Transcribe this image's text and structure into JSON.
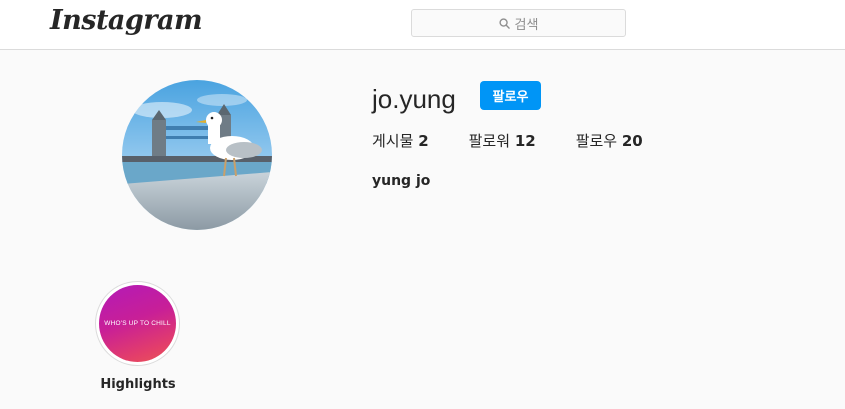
{
  "header": {
    "logo_text": "Instagram",
    "search": {
      "placeholder": "검색",
      "icon": "search-icon"
    }
  },
  "profile": {
    "avatar": {
      "description_icon": "profile-photo-seagull-tower-bridge"
    },
    "username": "jo.yung",
    "follow_label": "팔로우",
    "follow_color": "#0095f6",
    "stats": [
      {
        "label": "게시물",
        "count": "2"
      },
      {
        "label": "팔로워",
        "count": "12"
      },
      {
        "label": "팔로우",
        "count": "20"
      }
    ],
    "full_name": "yung jo"
  },
  "highlights": [
    {
      "cover_text": "WHO'S UP TO CHILL",
      "label": "Highlights"
    }
  ],
  "colors": {
    "background": "#fafafa",
    "text": "#262626",
    "border": "#dbdbdb",
    "accent": "#0095f6"
  }
}
